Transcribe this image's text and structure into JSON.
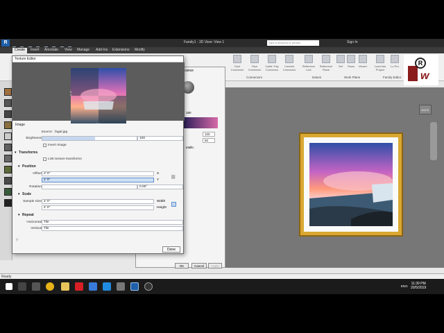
{
  "titlebar": {
    "doc_title": "Family1 - 3D View: View 1",
    "search_placeholder": "Type a keyword or phrase",
    "sign_in": "Sign In"
  },
  "ribbon_tabs": [
    "Create",
    "Insert",
    "Annotate",
    "View",
    "Manage",
    "Add-Ins",
    "Extensions",
    "Modify"
  ],
  "ribbon_buttons": [
    "Duct Connector",
    "Pipe Connector",
    "Cable Tray Connector",
    "Conduit Connector",
    "Reference Line",
    "Reference Plane",
    "Set",
    "Show",
    "Viewer",
    "Load into Project",
    "Lo Pro"
  ],
  "ribbon_groups": {
    "connectors": "Connectors",
    "datum": "Datum",
    "work_plane": "Work Plane",
    "family_editor": "Family Editor"
  },
  "texture_editor": {
    "title": "Texture Editor",
    "dim_x": "4' 0\"",
    "dim_y": "4' 0\"",
    "image_section": "Image",
    "source_label": "Source:",
    "source_value": "fagal.jpg",
    "brightness_label": "Brightness",
    "brightness_value": "100",
    "brightness_level_pct": 56,
    "invert_label": "Invert Image",
    "transforms_section": "Transforms",
    "link_label": "Link texture transforms",
    "position_section": "Position",
    "offset_label": "Offset",
    "offset_x": "2' 0\"",
    "offset_y": "2' 0\"",
    "x_label": "X",
    "y_label": "Y",
    "rotation_label": "Rotation",
    "rotation_value": "0.00°",
    "scale_section": "Scale",
    "sample_size_label": "Sample Size",
    "width_value": "4' 0\"",
    "height_value": "4' 0\"",
    "width_label": "Width",
    "height_label": "Height",
    "repeat_section": "Repeat",
    "horizontal_label": "Horizontal",
    "horizontal_value": "Tile",
    "vertical_label": "Vertical",
    "vertical_value": "Tile",
    "done_label": "Done"
  },
  "props": {
    "appearance_tab": "Appearance",
    "val_100": "100",
    "val_50": "50",
    "val_180": "180",
    "ok": "OK",
    "cancel": "Cancel",
    "apply": "Apply",
    "metallic": "etallic"
  },
  "view": {
    "nav_cube": "BACK"
  },
  "statusbar": {
    "text": "Ready"
  },
  "taskbar": {
    "time": "11:39 PM",
    "date": "20/5/2019",
    "lang": "ENG"
  },
  "colors": {
    "accent": "#1f5fa8",
    "frame_gold": "#d9a832",
    "selection": "#cfe0f5"
  }
}
